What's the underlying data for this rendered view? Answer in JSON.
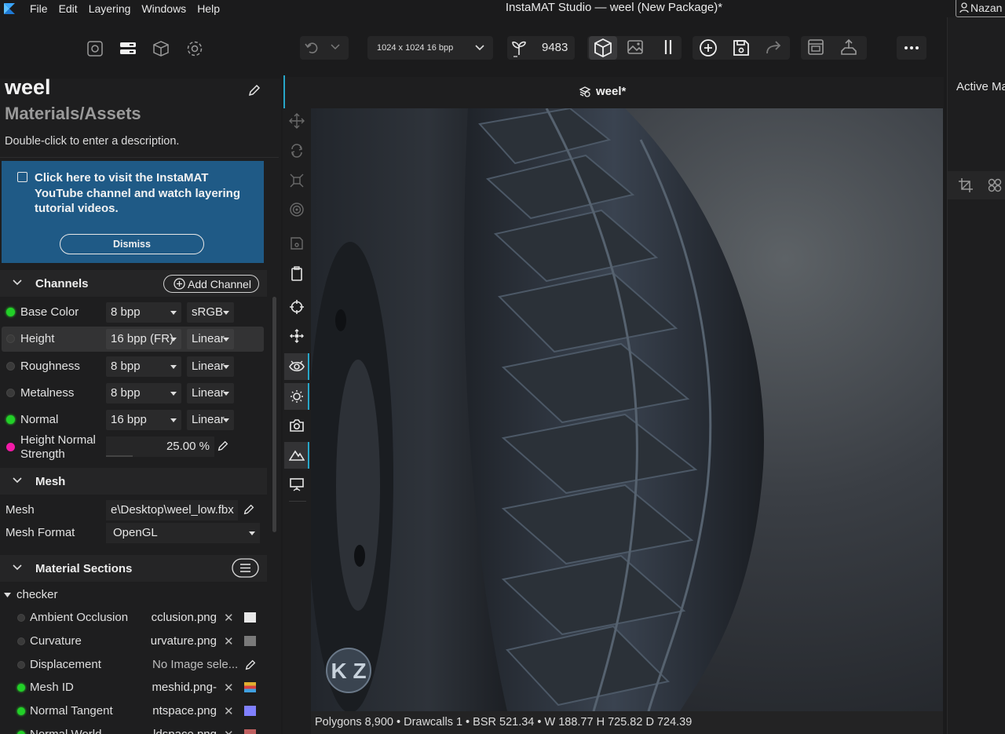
{
  "menubar": {
    "items": [
      "File",
      "Edit",
      "Layering",
      "Windows",
      "Help"
    ],
    "title": "InstaMAT Studio — weel (New Package)*",
    "user": "Nazan"
  },
  "package": {
    "name": "weel",
    "path": "Materials/Assets",
    "description": "Double-click to enter a description."
  },
  "banner": {
    "text": "Click here to visit the InstaMAT YouTube channel and watch layering tutorial videos.",
    "dismiss": "Dismiss"
  },
  "channels": {
    "title": "Channels",
    "add_label": "Add Channel",
    "items": [
      {
        "name": "Base Color",
        "depth": "8 bpp",
        "space": "sRGB",
        "status": "on"
      },
      {
        "name": "Height",
        "depth": "16 bpp (FR)",
        "space": "Linear",
        "status": "off"
      },
      {
        "name": "Roughness",
        "depth": "8 bpp",
        "space": "Linear",
        "status": "off"
      },
      {
        "name": "Metalness",
        "depth": "8 bpp",
        "space": "Linear",
        "status": "off"
      },
      {
        "name": "Normal",
        "depth": "16 bpp",
        "space": "Linear",
        "status": "on"
      }
    ],
    "height_normal": {
      "label": "Height Normal Strength",
      "value": "25.00 %"
    }
  },
  "mesh": {
    "title": "Mesh",
    "mesh_label": "Mesh",
    "mesh_value": "e\\Desktop\\weel_low.fbx",
    "format_label": "Mesh Format",
    "format_value": "OpenGL"
  },
  "material_sections": {
    "title": "Material Sections",
    "group": "checker",
    "items": [
      {
        "name": "Ambient Occlusion",
        "file": "cclusion.png",
        "status": "off",
        "thumb": "#e8e8e8"
      },
      {
        "name": "Curvature",
        "file": "urvature.png",
        "status": "off",
        "thumb": "#7a7a7a"
      },
      {
        "name": "Displacement",
        "file": "No Image sele...",
        "status": "off",
        "thumb": ""
      },
      {
        "name": "Mesh ID",
        "file": "-meshid.png",
        "status": "on",
        "thumb": "#e0b030"
      },
      {
        "name": "Normal Tangent",
        "file": "ntspace.png",
        "status": "on",
        "thumb": "#8080ff"
      },
      {
        "name": "Normal World",
        "file": "ldspace.png",
        "status": "on",
        "thumb": "#c06060"
      }
    ]
  },
  "toolbar": {
    "resolution": "1024 x 1024 16 bpp",
    "seed": "9483"
  },
  "viewport": {
    "tab": "weel*",
    "status": "Polygons 8,900 • Drawcalls 1 • BSR 521.34 • W 188.77 H 725.82 D 724.39",
    "logo_text": "K Z"
  },
  "right_panel": {
    "title": "Active Ma"
  }
}
